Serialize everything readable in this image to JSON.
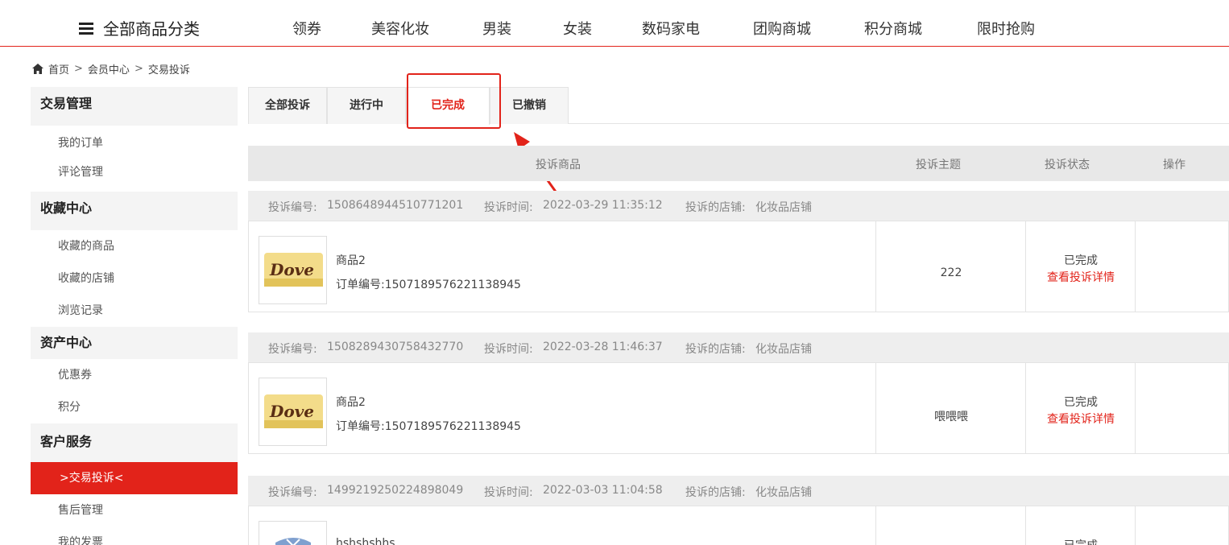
{
  "topnav": {
    "all_categories": "全部商品分类",
    "items": [
      "领券",
      "美容化妆",
      "男装",
      "女装",
      "数码家电",
      "团购商城",
      "积分商城",
      "限时抢购"
    ]
  },
  "breadcrumb": [
    "首页",
    "会员中心",
    "交易投诉"
  ],
  "sidebar": {
    "sections": [
      {
        "title": "交易管理",
        "items": [
          "我的订单",
          "评论管理"
        ]
      },
      {
        "title": "收藏中心",
        "items": [
          "收藏的商品",
          "收藏的店铺",
          "浏览记录"
        ]
      },
      {
        "title": "资产中心",
        "items": [
          "优惠券",
          "积分"
        ]
      },
      {
        "title": "客户服务",
        "items": [
          ">交易投诉<",
          "售后管理",
          "我的发票"
        ]
      }
    ]
  },
  "tabs": [
    "全部投诉",
    "进行中",
    "已完成",
    "已撤销"
  ],
  "table": {
    "headers": [
      "投诉商品",
      "投诉主题",
      "投诉状态",
      "操作"
    ]
  },
  "complaints": [
    {
      "no_label": "投诉编号:",
      "no": "1508648944510771201",
      "time_label": "投诉时间:",
      "time": "2022-03-29 11:35:12",
      "store_label": "投诉的店铺:",
      "store": "化妆品店铺",
      "product": "商品2",
      "order_label": "订单编号:",
      "order": "1507189576221138945",
      "topic": "222",
      "status": "已完成",
      "detail": "查看投诉详情"
    },
    {
      "no_label": "投诉编号:",
      "no": "1508289430758432770",
      "time_label": "投诉时间:",
      "time": "2022-03-28 11:46:37",
      "store_label": "投诉的店铺:",
      "store": "化妆品店铺",
      "product": "商品2",
      "order_label": "订单编号:",
      "order": "1507189576221138945",
      "topic": "喂喂喂",
      "status": "已完成",
      "detail": "查看投诉详情"
    },
    {
      "no_label": "投诉编号:",
      "no": "1499219250224898049",
      "time_label": "投诉时间:",
      "time": "2022-03-03 11:04:58",
      "store_label": "投诉的店铺:",
      "store": "化妆品店铺",
      "product": "hshshshhs",
      "status": "已完成"
    }
  ],
  "colors": {
    "accent": "#e2231a",
    "tab_bg": "#f5f5f5",
    "header_bg": "#e8e8e8",
    "group_bg": "#eeeeee"
  }
}
